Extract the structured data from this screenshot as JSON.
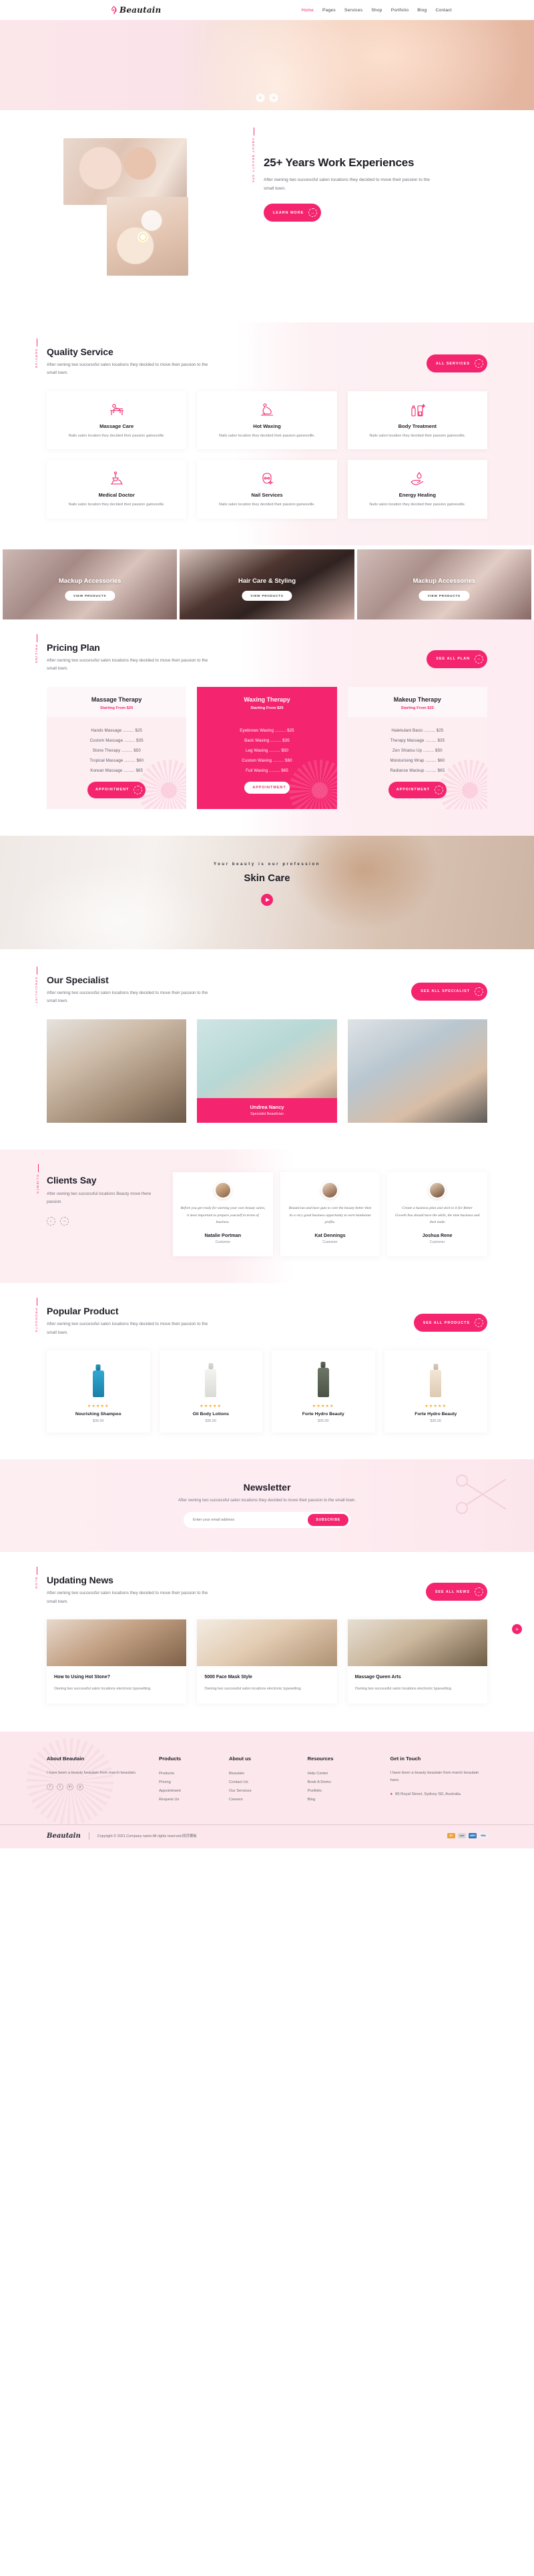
{
  "brand": {
    "name": "Beautain"
  },
  "nav": {
    "items": [
      {
        "label": "Home",
        "active": true
      },
      {
        "label": "Pages",
        "active": false
      },
      {
        "label": "Services",
        "active": false
      },
      {
        "label": "Shop",
        "active": false
      },
      {
        "label": "Portfolio",
        "active": false
      },
      {
        "label": "Blog",
        "active": false
      },
      {
        "label": "Contact",
        "active": false
      }
    ]
  },
  "hero": {
    "prev_icon": "‹",
    "next_icon": "›"
  },
  "about": {
    "vlabel": "ABOUT BEAUTY SPA",
    "title": "25+ Years Work Experiences",
    "text": "After owning two successful salon locations they decided to move their passion to the small town.",
    "button": "LEARN MORE",
    "arrow": "→"
  },
  "services": {
    "vlabel": "SERVICE",
    "title": "Quality Service",
    "text": "After owning two successful salon locations they decided to move their passion to the small town.",
    "button": "ALL SERVICES",
    "arrow": "→",
    "items": [
      {
        "icon": "massage-table-icon",
        "title": "Massage Care",
        "text": "Nails salon location they decided their passion gainesville."
      },
      {
        "icon": "waxing-icon",
        "title": "Hot Waxing",
        "text": "Nails salon location they decided their passion gainesville."
      },
      {
        "icon": "nail-polish-icon",
        "title": "Body Treatment",
        "text": "Nails salon location they decided their passion gainesville."
      },
      {
        "icon": "pedicure-icon",
        "title": "Medical Doctor",
        "text": "Nails salon location they decided their passion gainesville."
      },
      {
        "icon": "face-icon",
        "title": "Nail Services",
        "text": "Nails salon location they decided their passion gainesville."
      },
      {
        "icon": "hand-drop-icon",
        "title": "Energy Healing",
        "text": "Nails salon location they decided their passion gainesville."
      }
    ]
  },
  "gallery": {
    "button": "VIEW PRODUCTS",
    "items": [
      {
        "title": "Mackup Accessories"
      },
      {
        "title": "Hair Care & Styling"
      },
      {
        "title": "Mackup Accessories"
      }
    ]
  },
  "pricing": {
    "vlabel": "PRICING",
    "title": "Pricing Plan",
    "text": "After owning two successful salon locations they decided to move their passion to the small town.",
    "button": "SEE ALL PLAN",
    "arrow": "→",
    "appointment": "APPOINTMENT",
    "plans": [
      {
        "name": "Massage Therapy",
        "sub": "Starting From $25",
        "featured": false,
        "items": [
          "Hands Massage ......... $25",
          "Custom Massage ......... $35",
          "Stone Therapy ......... $50",
          "Tropical Massage ......... $60",
          "Korean Massage ......... $65"
        ]
      },
      {
        "name": "Waxing Therapy",
        "sub": "Starting From $25",
        "featured": true,
        "items": [
          "Eyebrows Waxing ......... $25",
          "Back Waxing ......... $35",
          "Leg Waxing ......... $50",
          "Custom Waxing ......... $60",
          "Full Waxing ......... $65"
        ]
      },
      {
        "name": "Makeup Therapy",
        "sub": "Starting From $25",
        "featured": false,
        "items": [
          "Halekulani Basic ......... $25",
          "Therapy Massage ......... $35",
          "Zen Shiatsu Up ......... $50",
          "Moisturising Wrap ......... $60",
          "Radiance Mackup ......... $65"
        ]
      }
    ]
  },
  "video": {
    "tagline": "Your beauty is our profession",
    "title": "Skin Care",
    "play_icon": "play-icon"
  },
  "specialist": {
    "vlabel": "SPECIALIST",
    "title": "Our Specialist",
    "text": "After owning two successful salon locations they decided to move their passion to the small town.",
    "button": "SEE ALL SPECIALIST",
    "arrow": "→",
    "members": [
      {
        "name": "",
        "role": ""
      },
      {
        "name": "Undrea Nancy",
        "role": "Specialist Beautician"
      },
      {
        "name": "",
        "role": ""
      }
    ]
  },
  "clients": {
    "vlabel": "CLIENTS",
    "title": "Clients Say",
    "text": "After owning two successful locations Beauty move there passion.",
    "prev": "←",
    "next": "→",
    "testimonials": [
      {
        "quote": "Before you get ready for starting your own beauty salon, it most important to prepare yourself in terms of business.",
        "name": "Natalie Portman",
        "role": "Customer"
      },
      {
        "quote": "Beautician and have guts to care the beauty better then its a very good business opportunity to earn handsome profits.",
        "name": "Kat Dennings",
        "role": "Customer"
      },
      {
        "quote": "Create a business plan and stick to it for Better Growth.You should have the skills, the time business and then make",
        "name": "Joshua Rene",
        "role": "Customer"
      }
    ]
  },
  "popular": {
    "vlabel": "PRODUCTS",
    "title": "Popular Product",
    "text": "After owning two successful salon locations they decided to move their passion to the small town.",
    "button": "SEE ALL PRODUCTS",
    "arrow": "→",
    "stars": "★★★★★",
    "items": [
      {
        "name": "Nourishing Shampoo",
        "price": "$35.00"
      },
      {
        "name": "Oil Body Lotions",
        "price": "$35.00"
      },
      {
        "name": "Forte Hydro Beauty",
        "price": "$35.00"
      },
      {
        "name": "Forte Hydro Beauty",
        "price": "$35.00"
      }
    ]
  },
  "newsletter": {
    "title": "Newsletter",
    "text": "After owning two successful salon locations they decided to move their passion to the small town.",
    "placeholder": "Enter your email address",
    "button": "SUBSCRIBE"
  },
  "blog": {
    "vlabel": "BLOG",
    "title": "Updating News",
    "text": "After owning two successful salon locations they decided to move their passion to the small town.",
    "button": "SEE ALL NEWS",
    "arrow": "→",
    "fab": "+",
    "posts": [
      {
        "title": "How to Using Hot Stone?",
        "text": "Owning two successful salon locations electronic typesetting."
      },
      {
        "title": "5000 Face Mask Style",
        "text": "Owning two successful salon locations electronic typesetting."
      },
      {
        "title": "Massage Queen Arts",
        "text": "Owning two successful salon locations electronic typesetting."
      }
    ]
  },
  "footer": {
    "about": {
      "title": "About Beautain",
      "text": "I have been a beauty beautain from march beautain.",
      "socials": [
        "f",
        "t",
        "in",
        "p"
      ]
    },
    "columns": [
      {
        "title": "Products",
        "links": [
          "Products",
          "Pricing",
          "Appointment",
          "Request Us"
        ]
      },
      {
        "title": "About us",
        "links": [
          "Beautain",
          "Contact Us",
          "Our Services",
          "Careers"
        ]
      },
      {
        "title": "Resources",
        "links": [
          "Help Center",
          "Book A Demo",
          "Portfolio",
          "Blog"
        ]
      }
    ],
    "contact": {
      "title": "Get in Touch",
      "text": "I have been a beauty beautain from march beautain have.",
      "pin_icon": "location-pin-icon",
      "address": "85 Royal Street, Sydney SD, Australia."
    },
    "bottom": {
      "logo": "Beautain",
      "copyright": "Copyright © 2021.Company name All rights reserved.网页模板",
      "cards": [
        "MC",
        "card",
        "AMEX",
        "VISA"
      ]
    }
  }
}
